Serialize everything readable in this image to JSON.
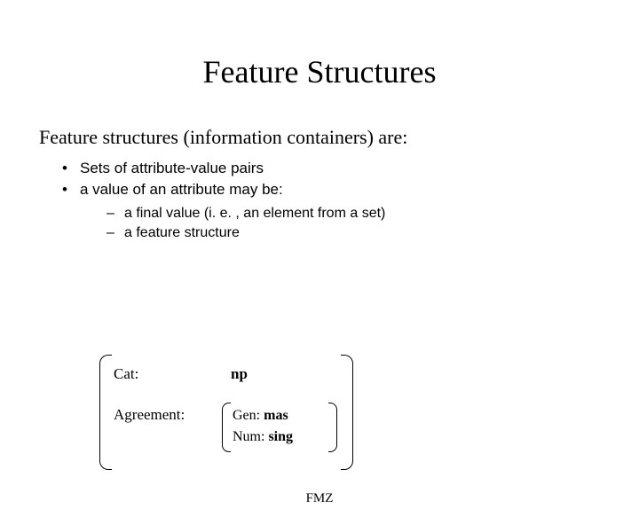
{
  "title": "Feature Structures",
  "intro": "Feature structures (information containers) are:",
  "bullets": [
    "Sets of attribute-value pairs",
    "a value of an attribute may be:"
  ],
  "subbullets": [
    "a final value (i. e. , an element from a set)",
    "a feature structure"
  ],
  "fs": {
    "cat_label": "Cat:",
    "cat_value": "np",
    "agr_label": "Agreement:",
    "nested": {
      "gen_label": "Gen: ",
      "gen_value": "mas",
      "num_label": "Num: ",
      "num_value": "sing"
    }
  },
  "footer": "FMZ"
}
